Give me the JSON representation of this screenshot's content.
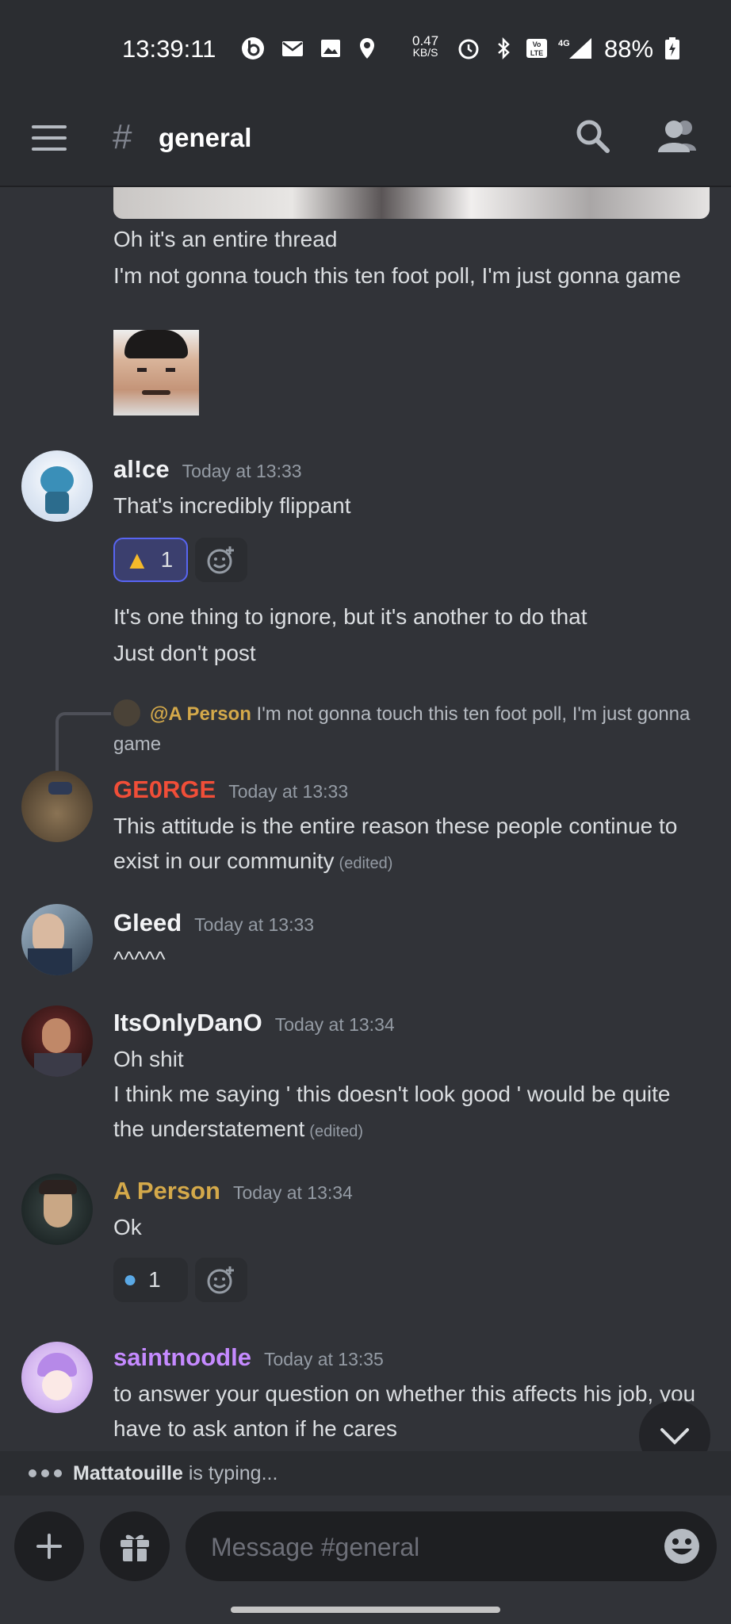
{
  "status_bar": {
    "time": "13:39:11",
    "net_speed_value": "0.47",
    "net_speed_unit": "KB/S",
    "network": "4G",
    "battery": "88%"
  },
  "header": {
    "hash": "#",
    "channel": "general"
  },
  "messages": {
    "prev": {
      "line1": "Oh it's an entire thread",
      "line2": "I'm not gonna touch this ten foot poll, I'm just gonna game"
    },
    "alice": {
      "username": "al!ce",
      "username_color": "#f2f3f5",
      "timestamp": "Today at 13:33",
      "text": "That's incredibly flippant",
      "reaction_count": "1",
      "text2_line1": "It's one thing to ignore, but it's another to do that",
      "text2_line2": "Just don't post"
    },
    "george": {
      "reply_mention": "@A Person",
      "reply_text": "I'm not gonna touch this ten foot poll, I'm just gonna game",
      "username": "GE0RGE",
      "username_color": "#f04e38",
      "timestamp": "Today at 13:33",
      "text": "This attitude is the entire reason these people continue to exist in our community",
      "edited": "(edited)"
    },
    "gleed": {
      "username": "Gleed",
      "timestamp": "Today at 13:33",
      "text": "^^^^^"
    },
    "dan": {
      "username": "ItsOnlyDanO",
      "timestamp": "Today at 13:34",
      "line1": "Oh shit",
      "line2": "I think me saying ' this doesn't look good ' would be quite the understatement",
      "edited": "(edited)"
    },
    "aperson": {
      "username": "A Person",
      "username_color": "#d4a94a",
      "timestamp": "Today at 13:34",
      "text": "Ok",
      "reaction_count": "1"
    },
    "saintnoodle": {
      "username": "saintnoodle",
      "username_color": "#c58aff",
      "timestamp": "Today at 13:35",
      "text": "to answer your question on whether this affects his job, you have to ask anton if he cares"
    }
  },
  "typing": {
    "user": "Mattatouille",
    "suffix": " is typing..."
  },
  "composer": {
    "placeholder": "Message #general"
  },
  "colors": {
    "background": "#313338",
    "header_bg": "#2b2d31",
    "accent": "#5865f2"
  }
}
